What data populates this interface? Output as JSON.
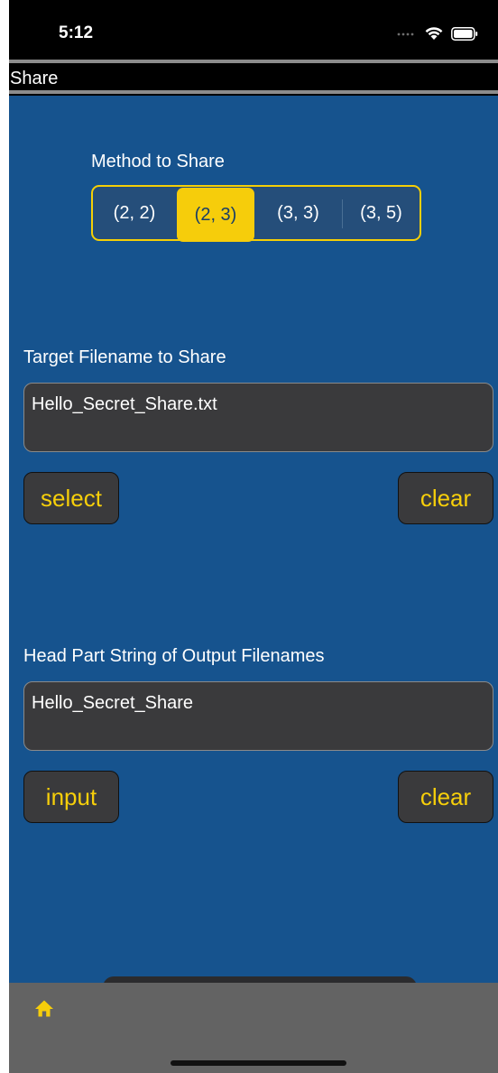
{
  "status_bar": {
    "time": "5:12",
    "icons": [
      "signal-dots-icon",
      "wifi-icon",
      "battery-icon"
    ]
  },
  "nav": {
    "title": "Share"
  },
  "method": {
    "label": "Method to Share",
    "options": [
      "(2, 2)",
      "(2, 3)",
      "(3, 3)",
      "(3, 5)"
    ],
    "selected": "(2, 3)"
  },
  "target": {
    "label": "Target Filename to Share",
    "value": "Hello_Secret_Share.txt",
    "select_label": "select",
    "clear_label": "clear"
  },
  "head_part": {
    "label": "Head Part String of Output Filenames",
    "value": "Hello_Secret_Share",
    "input_label": "input",
    "clear_label": "clear"
  },
  "tab_bar": {
    "icon": "home-icon"
  },
  "colors": {
    "accent": "#f6cd0b",
    "background": "#16538e",
    "field": "#3a3a3c",
    "tab_bar": "#636363"
  }
}
